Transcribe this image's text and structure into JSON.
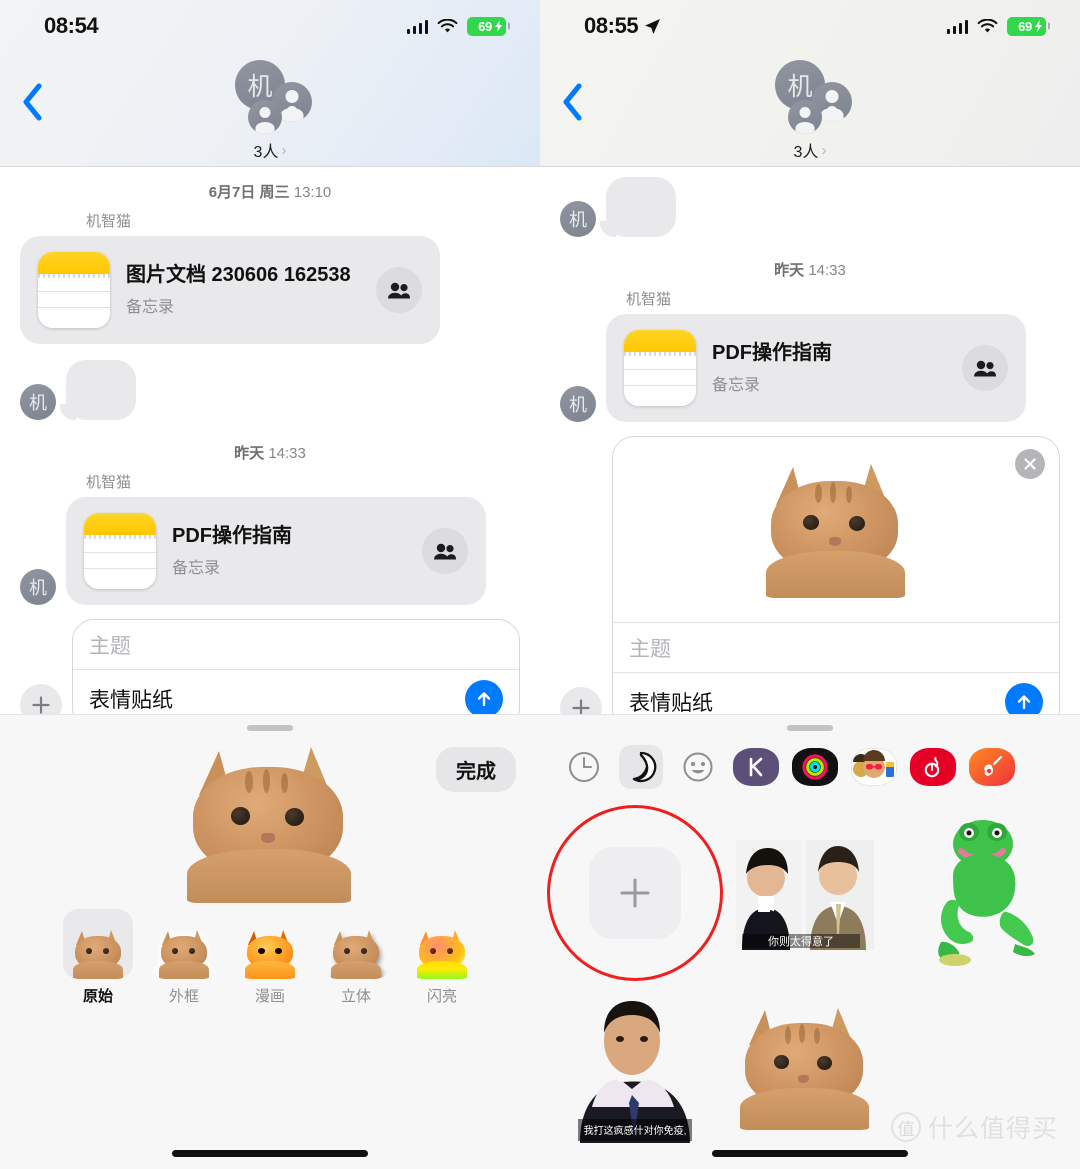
{
  "left": {
    "status": {
      "time": "08:54",
      "battery_percent": "69",
      "battery_color": "#32d74b",
      "has_location": false
    },
    "nav": {
      "back_icon": "chevron-left-icon",
      "group_initial": "机",
      "member_count": "3人",
      "disclosure_icon": "chevron-right-icon"
    },
    "messages": [
      {
        "timestamp_date": "6月7日 周三",
        "timestamp_time": "13:10",
        "sender": "机智猫",
        "card_title": "图片文档 230606 162538",
        "card_subtitle": "备忘录",
        "action_icon": "people-icon"
      },
      {
        "timestamp_date": "昨天",
        "timestamp_time": "14:33",
        "sender": "机智猫",
        "card_title": "PDF操作指南",
        "card_subtitle": "备忘录",
        "action_icon": "people-icon"
      }
    ],
    "composer": {
      "plus_icon": "plus-icon",
      "subject_placeholder": "主题",
      "message_text": "表情贴纸",
      "send_icon": "arrow-up-icon",
      "send_color": "#007aff"
    },
    "sheet": {
      "done_label": "完成",
      "styles": [
        {
          "label": "原始",
          "selected": true
        },
        {
          "label": "外框",
          "selected": false
        },
        {
          "label": "漫画",
          "selected": false
        },
        {
          "label": "立体",
          "selected": false
        },
        {
          "label": "闪亮",
          "selected": false
        }
      ]
    }
  },
  "right": {
    "status": {
      "time": "08:55",
      "battery_percent": "69",
      "battery_color": "#32d74b",
      "has_location": true
    },
    "nav": {
      "back_icon": "chevron-left-icon",
      "group_initial": "机",
      "member_count": "3人",
      "disclosure_icon": "chevron-right-icon"
    },
    "messages": [
      {
        "timestamp_date": "昨天",
        "timestamp_time": "14:33",
        "sender": "机智猫",
        "card_title": "PDF操作指南",
        "card_subtitle": "备忘录",
        "action_icon": "people-icon"
      }
    ],
    "composer": {
      "plus_icon": "plus-icon",
      "subject_placeholder": "主题",
      "message_text": "表情贴纸",
      "send_icon": "arrow-up-icon",
      "send_color": "#007aff",
      "attachment_close_icon": "close-circle-icon"
    },
    "sheet": {
      "tabs": [
        {
          "name": "recents-tab",
          "icon": "clock-icon",
          "selected": false
        },
        {
          "name": "stickers-tab",
          "icon": "sticker-icon",
          "selected": true
        },
        {
          "name": "emoji-tab",
          "icon": "smiley-icon",
          "selected": false
        },
        {
          "name": "keep-tab",
          "icon": "keep-app-icon",
          "selected": false
        },
        {
          "name": "fitness-tab",
          "icon": "activity-rings-icon",
          "selected": false
        },
        {
          "name": "memoji-tab",
          "icon": "memoji-icon",
          "selected": false
        },
        {
          "name": "netease-music-tab",
          "icon": "netease-music-icon",
          "selected": false
        },
        {
          "name": "garageband-tab",
          "icon": "guitar-icon",
          "selected": false
        }
      ],
      "add_sticker_icon": "plus-icon",
      "highlight_color": "#f01f1f",
      "stickers": [
        {
          "name": "add-sticker-button",
          "kind": "add",
          "highlighted": true
        },
        {
          "name": "sticker-couple",
          "kind": "photo-couple",
          "caption": "你则太得意了"
        },
        {
          "name": "sticker-green-frog",
          "kind": "photo-frog"
        },
        {
          "name": "sticker-man-suit",
          "kind": "photo-man",
          "caption": "我打这疯感什对你免疫,"
        },
        {
          "name": "sticker-cat",
          "kind": "photo-cat"
        }
      ]
    },
    "watermark": {
      "mark": "值",
      "text": "什么值得买"
    }
  }
}
